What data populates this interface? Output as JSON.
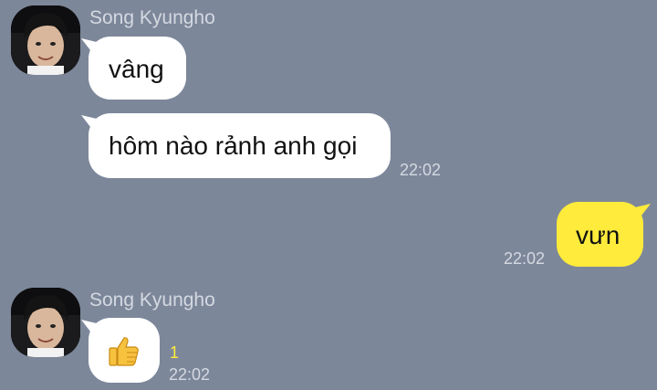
{
  "chat": {
    "messages": [
      {
        "sender": "Song Kyungho",
        "texts": [
          "vâng",
          "hôm nào rảnh anh gọi"
        ],
        "time": "22:02"
      },
      {
        "sender": "me",
        "texts": [
          "vưn"
        ],
        "time": "22:02"
      },
      {
        "sender": "Song Kyungho",
        "emoji": "thumbs-up",
        "unread": "1",
        "time": "22:02"
      }
    ]
  },
  "colors": {
    "background": "#7d879a",
    "incoming_bubble": "#ffffff",
    "outgoing_bubble": "#ffeb3b",
    "meta_text": "#d4d9e1",
    "unread": "#ffeb3b"
  }
}
